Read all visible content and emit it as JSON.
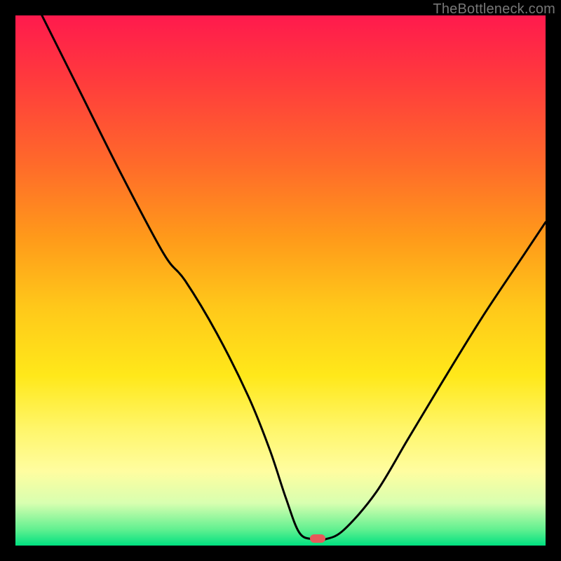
{
  "watermark": "TheBottleneck.com",
  "chart_data": {
    "type": "line",
    "title": "",
    "xlabel": "",
    "ylabel": "",
    "xlim": [
      0,
      100
    ],
    "ylim": [
      0,
      100
    ],
    "grid": false,
    "legend": false,
    "background": "red-yellow-green vertical gradient",
    "series": [
      {
        "name": "curve",
        "color": "#000000",
        "x": [
          5,
          12,
          20,
          28,
          32,
          38,
          44,
          48,
          51,
          53.5,
          56,
          58.5,
          62,
          68,
          74,
          80,
          88,
          96,
          100
        ],
        "values": [
          100,
          86,
          70,
          55,
          50,
          40,
          28,
          18,
          9,
          2.5,
          1.2,
          1.2,
          3,
          10,
          20,
          30,
          43,
          55,
          61
        ]
      }
    ],
    "annotations": [
      {
        "type": "pill-marker",
        "x": 57,
        "y": 1.3,
        "color": "#e65a5a"
      }
    ]
  }
}
